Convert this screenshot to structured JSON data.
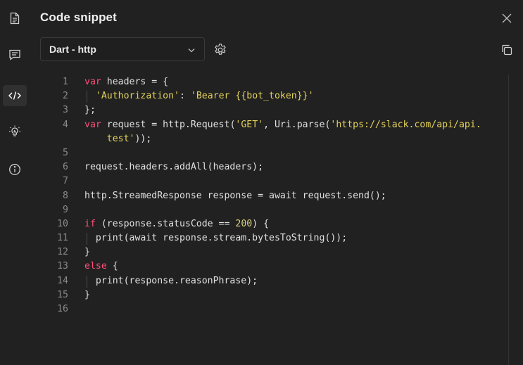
{
  "rail": {
    "items": [
      {
        "name": "documentation-icon",
        "active": false
      },
      {
        "name": "comments-icon",
        "active": false
      },
      {
        "name": "code-icon",
        "active": true
      },
      {
        "name": "lightbulb-icon",
        "active": false
      },
      {
        "name": "info-icon",
        "active": false
      }
    ]
  },
  "panel": {
    "title": "Code snippet",
    "language": "Dart - http"
  },
  "colors": {
    "keyword": "#ff4f7a",
    "string": "#e3d25b",
    "number": "#d9d27a",
    "background": "#212121"
  },
  "code": {
    "lines": [
      {
        "n": "1",
        "tokens": [
          {
            "t": "var",
            "c": "kw"
          },
          {
            "t": " headers = {"
          }
        ]
      },
      {
        "n": "2",
        "indent": true,
        "tokens": [
          {
            "t": "  "
          },
          {
            "t": "'Authorization'",
            "c": "str"
          },
          {
            "t": ": "
          },
          {
            "t": "'Bearer {{bot_token}}'",
            "c": "str"
          }
        ]
      },
      {
        "n": "3",
        "tokens": [
          {
            "t": "};"
          }
        ]
      },
      {
        "n": "4",
        "tokens": [
          {
            "t": "var",
            "c": "kw"
          },
          {
            "t": " request = http.Request("
          },
          {
            "t": "'GET'",
            "c": "str"
          },
          {
            "t": ", Uri.parse("
          },
          {
            "t": "'https://slack.com/api/api.",
            "c": "str"
          }
        ]
      },
      {
        "n": "",
        "tokens": [
          {
            "t": "    "
          },
          {
            "t": "test'",
            "c": "str"
          },
          {
            "t": "));"
          }
        ]
      },
      {
        "n": "5",
        "tokens": []
      },
      {
        "n": "6",
        "tokens": [
          {
            "t": "request.headers.addAll(headers);"
          }
        ]
      },
      {
        "n": "7",
        "tokens": []
      },
      {
        "n": "8",
        "tokens": [
          {
            "t": "http.StreamedResponse response = await request.send();"
          }
        ]
      },
      {
        "n": "9",
        "tokens": []
      },
      {
        "n": "10",
        "tokens": [
          {
            "t": "if",
            "c": "kw"
          },
          {
            "t": " (response.statusCode == "
          },
          {
            "t": "200",
            "c": "num"
          },
          {
            "t": ") {"
          }
        ]
      },
      {
        "n": "11",
        "indent": true,
        "tokens": [
          {
            "t": "  print(await response.stream.bytesToString());"
          }
        ]
      },
      {
        "n": "12",
        "tokens": [
          {
            "t": "}"
          }
        ]
      },
      {
        "n": "13",
        "tokens": [
          {
            "t": "else",
            "c": "kw"
          },
          {
            "t": " {"
          }
        ]
      },
      {
        "n": "14",
        "indent": true,
        "tokens": [
          {
            "t": "  print(response.reasonPhrase);"
          }
        ]
      },
      {
        "n": "15",
        "tokens": [
          {
            "t": "}"
          }
        ]
      },
      {
        "n": "16",
        "tokens": []
      }
    ]
  }
}
